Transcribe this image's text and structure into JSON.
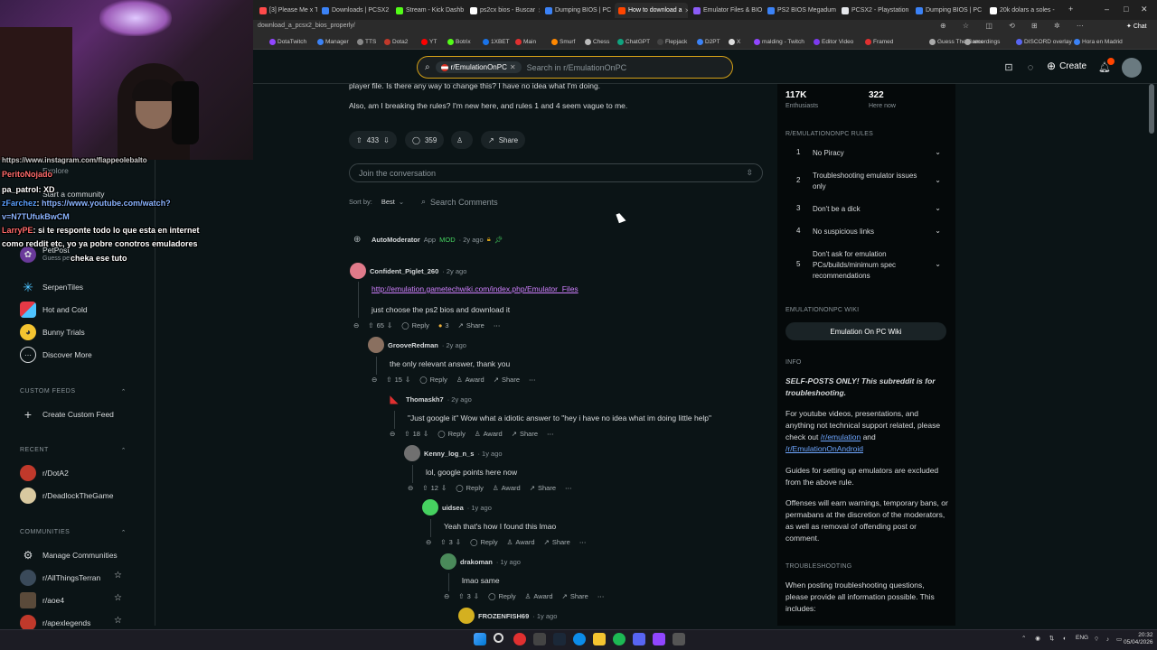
{
  "browser": {
    "tabs": [
      {
        "label": "[3] Please Me x Titu",
        "color": "#ff4a4a"
      },
      {
        "label": "Downloads | PCSX2",
        "color": "#3b82f6"
      },
      {
        "label": "Stream - Kick Dashb",
        "color": "#53fc18"
      },
      {
        "label": "ps2cx bios - Buscar",
        "color": "#ffffff"
      },
      {
        "label": "Dumping BIOS | PC",
        "color": "#3b82f6"
      },
      {
        "label": "How to download a",
        "color": "#ff4500"
      },
      {
        "label": "Emulator Files & BIO",
        "color": "#8b5cf6"
      },
      {
        "label": "PS2 BIOS Megadum",
        "color": "#3b82f6"
      },
      {
        "label": "PCSX2 - Playstation",
        "color": "#e5e7eb"
      },
      {
        "label": "Dumping BIOS | PC",
        "color": "#3b82f6"
      },
      {
        "label": "20k dolars a soles -",
        "color": "#ffffff"
      }
    ],
    "url": "download_a_pcsx2_bios_properly/",
    "chat_button": "Chat",
    "bookmarks": [
      "DotaTwitch",
      "Manager",
      "TTS",
      "Dota2",
      "YT",
      "Botrix",
      "1XBET",
      "Main",
      "Smurf",
      "Chess",
      "ChatGPT",
      "Flepjack",
      "D2PT",
      "X",
      "malding - Twitch",
      "Editor Video",
      "Framed",
      "Guess The Game",
      "recordings",
      "DISCORD overlay",
      "Hora en Madrid"
    ]
  },
  "header": {
    "search_chip": "r/EmulationOnPC",
    "search_placeholder": "Search in r/EmulationOnPC",
    "create_label": "Create",
    "notif_count": "1"
  },
  "post": {
    "body_line1": "player file. Is there any way to change this? I have no idea what I'm doing.",
    "body_line2": "Also, am I breaking the rules? I'm new here, and rules 1 and 4 seem vague to me.",
    "votes": "433",
    "comments": "359",
    "share": "Share",
    "join_placeholder": "Join the conversation",
    "sort_label": "Sort by:",
    "sort_value": "Best",
    "search_comments": "Search Comments"
  },
  "comments": [
    {
      "user": "AutoModerator",
      "meta": "· 2y ago",
      "badge": "MOD",
      "badge_prefix": "App"
    },
    {
      "user": "Confident_Piglet_260",
      "meta": "· 2y ago",
      "link": "http://emulation.gametechwiki.com/index.php/Emulator_Files",
      "text": "just choose the ps2 bios and download it",
      "votes": "65",
      "awards": "3",
      "reply": "Reply",
      "share": "Share"
    },
    {
      "user": "GrooveRedman",
      "meta": "· 2y ago",
      "text": "the only relevant answer, thank you",
      "votes": "15",
      "reply": "Reply",
      "award": "Award",
      "share": "Share"
    },
    {
      "user": "Thomaskh7",
      "meta": "· 2y ago",
      "text": "\"Just google it\" Wow what a idiotic answer to \"hey i have no idea what im doing little help\"",
      "votes": "18",
      "reply": "Reply",
      "award": "Award",
      "share": "Share"
    },
    {
      "user": "Kenny_log_n_s",
      "meta": "· 1y ago",
      "text": "lol, google points here now",
      "votes": "12",
      "reply": "Reply",
      "award": "Award",
      "share": "Share"
    },
    {
      "user": "uidsea",
      "meta": "· 1y ago",
      "text": "Yeah that's how I found this lmao",
      "votes": "3",
      "reply": "Reply",
      "award": "Award",
      "share": "Share"
    },
    {
      "user": "drakoman",
      "meta": "· 1y ago",
      "text": "lmao same",
      "votes": "3",
      "reply": "Reply",
      "award": "Award",
      "share": "Share"
    },
    {
      "user": "FROZENFISH69",
      "meta": "· 1y ago"
    }
  ],
  "sidebar": {
    "members": "117K",
    "members_label": "Enthusiasts",
    "online": "322",
    "online_label": "Here now",
    "rules_head": "R/EMULATIONONPC RULES",
    "rules": [
      {
        "n": "1",
        "t": "No Piracy"
      },
      {
        "n": "2",
        "t": "Troubleshooting emulator issues only"
      },
      {
        "n": "3",
        "t": "Don't be a dick"
      },
      {
        "n": "4",
        "t": "No suspicious links"
      },
      {
        "n": "5",
        "t": "Don't ask for emulation PCs/builds/minimum spec recommendations"
      }
    ],
    "wiki_head": "EMULATIONONPC WIKI",
    "wiki_button": "Emulation On PC Wiki",
    "info_head": "INFO",
    "info_bold": "SELF-POSTS ONLY! This subreddit is for troubleshooting.",
    "info_p1_pre": "For youtube videos, presentations, and anything not technical support related, please check out",
    "info_p1_link1": "/r/emulation",
    "info_p1_and": "and",
    "info_p1_link2": "/r/EmulationOnAndroid",
    "info_p2": "Guides for setting up emulators are excluded from the above rule.",
    "info_p3": "Offenses will earn warnings, temporary bans, or permabans at the discretion of the moderators, as well as removal of offending post or comment.",
    "trouble_head": "TROUBLESHOOTING",
    "trouble_p": "When posting troubleshooting questions, please provide all information possible. This includes:"
  },
  "leftnav": {
    "explore": "Explore",
    "start_community": "Start a community",
    "games": [
      {
        "label": "PetPost",
        "sub": "Guess pet names"
      },
      {
        "label": "SerpenTiles"
      },
      {
        "label": "Hot and Cold"
      },
      {
        "label": "Bunny Trials"
      },
      {
        "label": "Discover More"
      }
    ],
    "custom_feeds_head": "CUSTOM FEEDS",
    "create_feed": "Create Custom Feed",
    "recent_head": "RECENT",
    "recent": [
      "r/DotA2",
      "r/DeadlockTheGame"
    ],
    "communities_head": "COMMUNITIES",
    "manage": "Manage Communities",
    "communities": [
      "r/AllThingsTerran",
      "r/aoe4",
      "r/apexlegends"
    ]
  },
  "stream_chat": [
    {
      "name": "PeritoNojado",
      "text": ""
    },
    {
      "name": "pa_patrol",
      "text": ": XD"
    },
    {
      "name": "zFarchez",
      "text": ": ",
      "link": "https://www.youtube.com/watch?"
    },
    {
      "name": "",
      "text": "",
      "link": "v=N7TUfukBwCM"
    },
    {
      "name": "LarryPE",
      "text": ": si te responte todo lo que esta en internet"
    },
    {
      "name": "",
      "text": "como reddit etc, yo ya pobre conotros emuladores"
    },
    {
      "name": "",
      "text": "cheka ese tuto"
    }
  ],
  "stream_chat_top": "https://www.instagram.com/flappeolebalto",
  "taskbar": {
    "lang": "ENG",
    "time": "20:32",
    "date": "05/04/2026"
  }
}
